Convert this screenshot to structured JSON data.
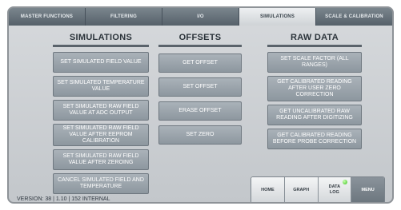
{
  "tabs": [
    "MASTER FUNCTIONS",
    "FILTERING",
    "I/O",
    "SIMULATIONS",
    "SCALE & CALIBRATION"
  ],
  "active_tab": "SIMULATIONS",
  "simulations": {
    "title": "SIMULATIONS",
    "buttons": [
      "SET SIMULATED FIELD VALUE",
      "SET SIMULATED TEMPERATURE VALUE",
      "SET SIMULATED RAW FIELD VALUE AT ADC OUTPUT",
      "SET SIMULATED RAW FIELD VALUE AFTER EEPROM CALIBRATION",
      "SET SIMULATED RAW FIELD VALUE AFTER ZEROING",
      "CANCEL SIMULATED FIELD AND TEMPERATURE"
    ]
  },
  "offsets": {
    "title": "OFFSETS",
    "buttons": [
      "GET OFFSET",
      "SET OFFSET",
      "ERASE OFFSET",
      "SET ZERO"
    ]
  },
  "raw_data": {
    "title": "RAW DATA",
    "buttons": [
      "SET SCALE FACTOR (ALL RANGES)",
      "GET CALIBRATED READING AFTER USER ZERO CORRECTION",
      "GET UNCALIBRATED RAW READING AFTER DIGITIZING",
      "GET CALIBRATED READING BEFORE PROBE CORRECTION"
    ]
  },
  "version": "VERSION: 38 | 1.10 | 152 INTERNAL",
  "nav": {
    "home": "HOME",
    "graph": "GRAPH",
    "data_log": "DATA LOG",
    "menu": "MENU",
    "led_color": "#38c21a"
  }
}
